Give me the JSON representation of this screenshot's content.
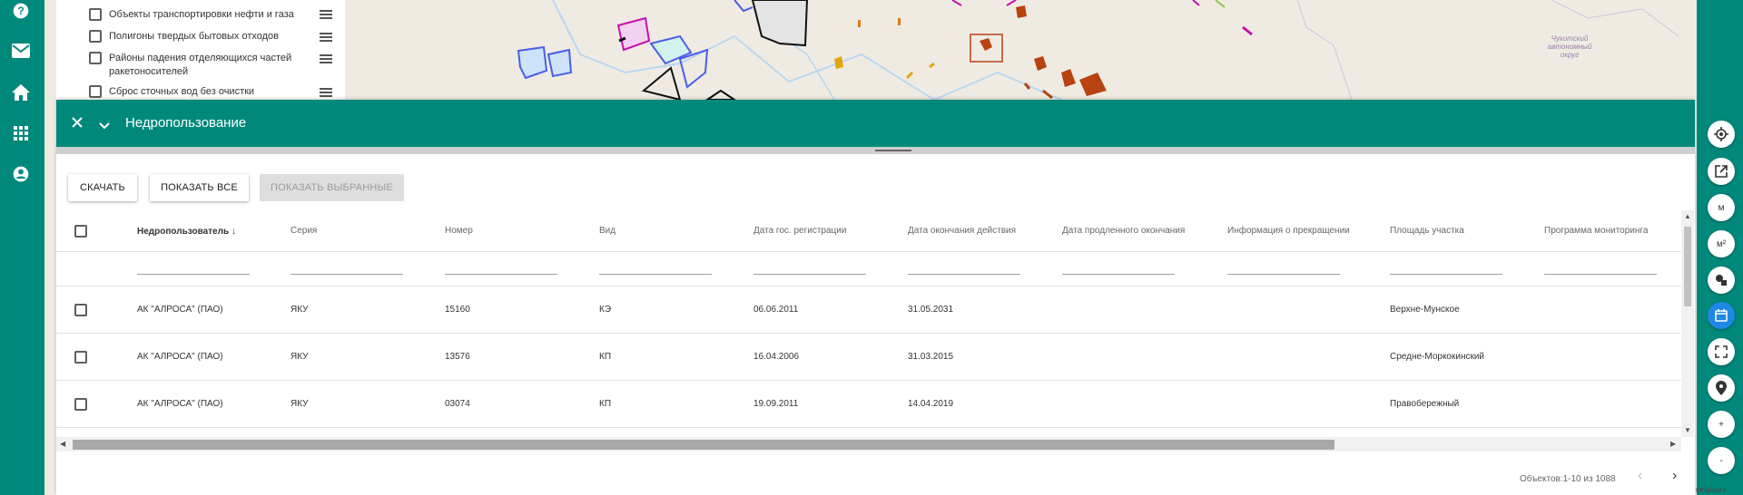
{
  "map": {
    "region_label": "Чукотский автономный округ"
  },
  "layers": [
    {
      "label": "Объекты транспортировки нефти и газа"
    },
    {
      "label": "Полигоны твердых бытовых отходов"
    },
    {
      "label": "Районы падения отделяющихся частей ракетоносителей"
    },
    {
      "label": "Сброс сточных вод без очистки"
    }
  ],
  "nav": {
    "icons": [
      "help-icon",
      "mail-icon",
      "home-icon",
      "apps-grid-icon",
      "account-icon"
    ]
  },
  "controls": {
    "distance_label": "м",
    "area_label": "м²",
    "zoom_in": "+",
    "zoom_out": "-"
  },
  "attribution": "ntributors",
  "panel": {
    "title": "Недропользование",
    "download_label": "СКАЧАТЬ",
    "show_all_label": "ПОКАЗАТЬ ВСЕ",
    "show_selected_label": "ПОКАЗАТЬ ВЫБРАННЫЕ"
  },
  "table": {
    "columns": [
      "Недропользователь",
      "Серия",
      "Номер",
      "Вид",
      "Дата гос. регистрации",
      "Дата окончания действия",
      "Дата продленного окончания",
      "Информация о прекращении",
      "Площадь участка",
      "Программа мониторинга"
    ],
    "rows": [
      [
        "АК \"АЛРОСА\" (ПАО)",
        "ЯКУ",
        "15160",
        "КЭ",
        "06.06.2011",
        "31.05.2031",
        "",
        "",
        "Верхне-Мунское",
        ""
      ],
      [
        "АК \"АЛРОСА\" (ПАО)",
        "ЯКУ",
        "13576",
        "КП",
        "16.04.2006",
        "31.03.2015",
        "",
        "",
        "Средне-Моркокинский",
        ""
      ],
      [
        "АК \"АЛРОСА\" (ПАО)",
        "ЯКУ",
        "03074",
        "КП",
        "19.09.2011",
        "14.04.2019",
        "",
        "",
        "Правобережный",
        ""
      ]
    ]
  },
  "pagination": {
    "info": "Объектов:1-10 из 1088",
    "prev": "‹",
    "next": "›"
  },
  "colors": {
    "primary": "#00897b",
    "active_control": "#1e88e5"
  }
}
